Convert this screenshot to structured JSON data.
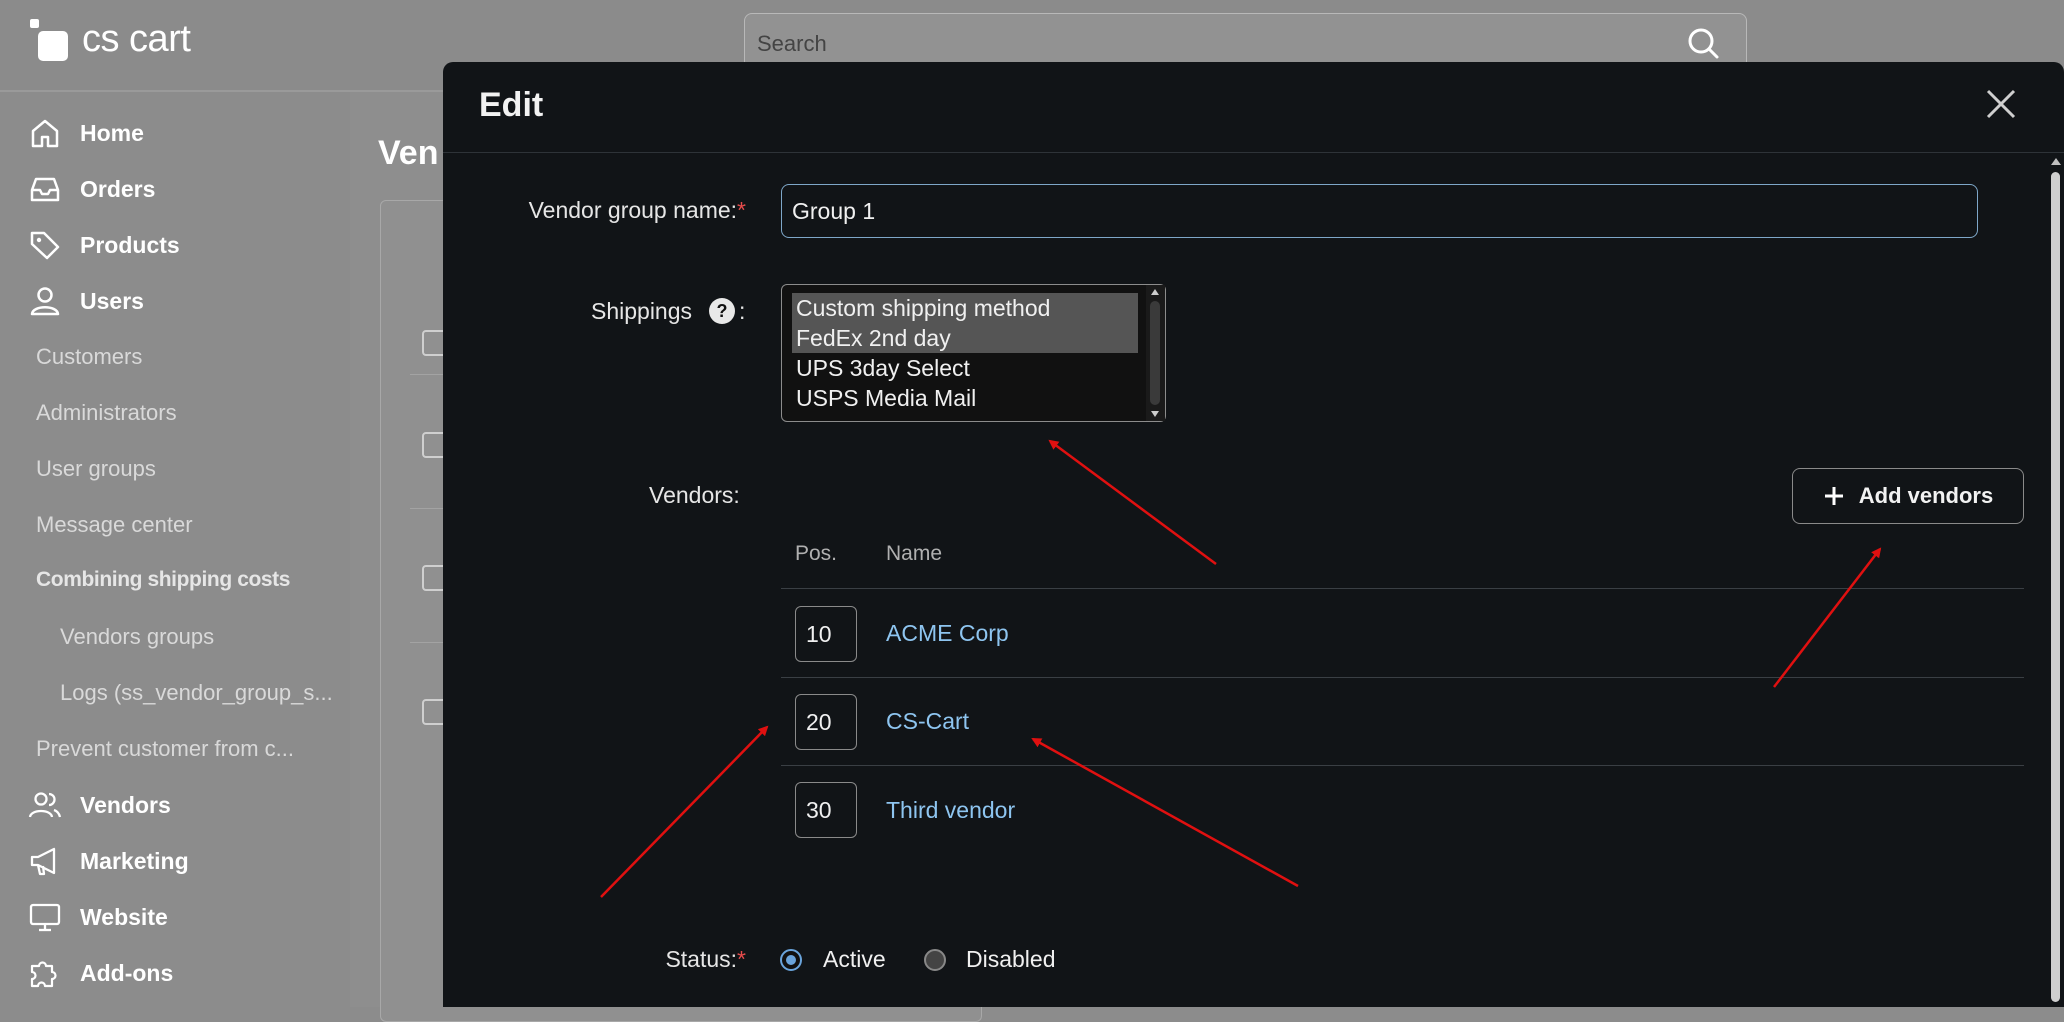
{
  "app": {
    "logo_text": "cs cart"
  },
  "search": {
    "placeholder": "Search"
  },
  "sidebar": {
    "items": [
      {
        "label": "Home",
        "icon": "home-icon"
      },
      {
        "label": "Orders",
        "icon": "inbox-icon"
      },
      {
        "label": "Products",
        "icon": "tag-icon"
      },
      {
        "label": "Users",
        "icon": "user-icon"
      },
      {
        "label": "Customers"
      },
      {
        "label": "Administrators"
      },
      {
        "label": "User groups"
      },
      {
        "label": "Message center"
      },
      {
        "label": "Combining shipping costs"
      },
      {
        "label": "Vendors groups"
      },
      {
        "label": "Logs (ss_vendor_group_s..."
      },
      {
        "label": "Prevent customer from c..."
      },
      {
        "label": "Vendors",
        "icon": "users-icon"
      },
      {
        "label": "Marketing",
        "icon": "megaphone-icon"
      },
      {
        "label": "Website",
        "icon": "monitor-icon"
      },
      {
        "label": "Add-ons",
        "icon": "puzzle-icon"
      }
    ]
  },
  "page": {
    "title_fragment": "Ven"
  },
  "modal": {
    "title": "Edit",
    "vendor_group_name_label": "Vendor group name:",
    "vendor_group_name_value": "Group 1",
    "required_mark": "*",
    "shippings_label": "Shippings",
    "shippings_colon": ":",
    "help_glyph": "?",
    "shipping_options": [
      {
        "label": "Custom shipping method",
        "selected": true
      },
      {
        "label": "FedEx 2nd day",
        "selected": true
      },
      {
        "label": "UPS 3day Select",
        "selected": false
      },
      {
        "label": "USPS Media Mail",
        "selected": false
      }
    ],
    "vendors_label": "Vendors:",
    "add_vendors_label": "Add vendors",
    "table": {
      "headers": {
        "pos": "Pos.",
        "name": "Name"
      },
      "rows": [
        {
          "pos": "10",
          "name": "ACME Corp"
        },
        {
          "pos": "20",
          "name": "CS-Cart"
        },
        {
          "pos": "30",
          "name": "Third vendor"
        }
      ]
    },
    "status_label": "Status:",
    "status_options": [
      {
        "label": "Active",
        "checked": true
      },
      {
        "label": "Disabled",
        "checked": false
      }
    ]
  },
  "colors": {
    "accent_link": "#8ec5f0",
    "annotation_arrow": "#e01010",
    "required": "#e74c4c",
    "modal_bg": "#111417"
  }
}
